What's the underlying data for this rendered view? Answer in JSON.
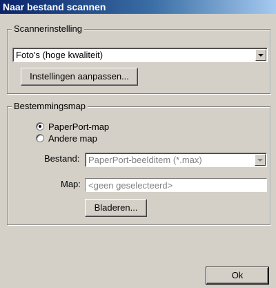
{
  "window": {
    "title": "Naar bestand scannen"
  },
  "scanner_group": {
    "legend": "Scannerinstelling",
    "preset_value": "Foto's (hoge kwaliteit)",
    "adjust_button": "Instellingen aanpassen..."
  },
  "destination_group": {
    "legend": "Bestemmingsmap",
    "radio_paperport": "PaperPort-map",
    "radio_other": "Andere map",
    "selected": "PaperPort-map",
    "file_label": "Bestand:",
    "file_value": "PaperPort-beelditem (*.max)",
    "folder_label": "Map:",
    "folder_value": "<geen geselecteerd>",
    "browse_button": "Bladeren..."
  },
  "footer": {
    "ok_button": "Ok"
  }
}
